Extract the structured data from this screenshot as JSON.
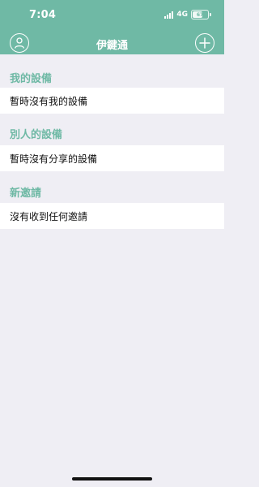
{
  "status_bar": {
    "time": "7:04",
    "network": "4G",
    "battery": "67"
  },
  "header": {
    "title": "伊鍵通"
  },
  "sections": {
    "my_devices": {
      "title": "我的設備",
      "empty_text": "暫時沒有我的設備"
    },
    "others_devices": {
      "title": "別人的設備",
      "empty_text": "暫時沒有分享的設備"
    },
    "new_invitations": {
      "title": "新邀請",
      "empty_text": "沒有收到任何邀請"
    }
  },
  "colors": {
    "accent": "#6fb9a5",
    "background": "#efeef4",
    "row": "#ffffff",
    "text": "#111111"
  },
  "icons": {
    "profile": "profile-icon",
    "add": "plus-icon",
    "signal": "signal-icon",
    "battery": "battery-icon"
  }
}
